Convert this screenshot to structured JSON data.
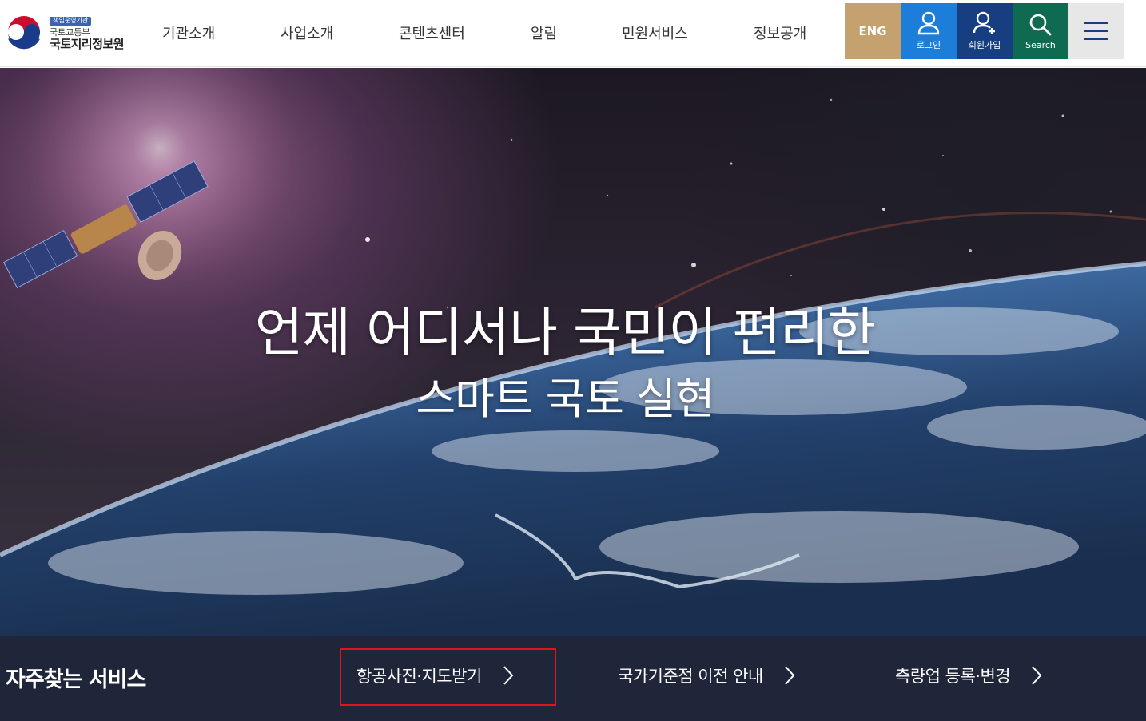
{
  "logo": {
    "badge": "책임운영기관",
    "ministry": "국토교통부",
    "agency": "국토지리정보원"
  },
  "nav": {
    "items": [
      "기관소개",
      "사업소개",
      "콘텐츠센터",
      "알림",
      "민원서비스",
      "정보공개"
    ]
  },
  "util": {
    "eng": "ENG",
    "login": "로그인",
    "join": "회원가입",
    "search": "Search"
  },
  "hero": {
    "title": "언제 어디서나 국민이 편리한",
    "subtitle": "스마트 국토 실현"
  },
  "quick": {
    "title": "자주찾는 서비스",
    "items": [
      "항공사진·지도받기",
      "국가기준점 이전 안내",
      "측량업 등록·변경"
    ]
  },
  "colors": {
    "eng": "#c5a16f",
    "login": "#1d7ed9",
    "join": "#163e80",
    "search": "#0f6a52",
    "highlight": "#e0141e"
  }
}
